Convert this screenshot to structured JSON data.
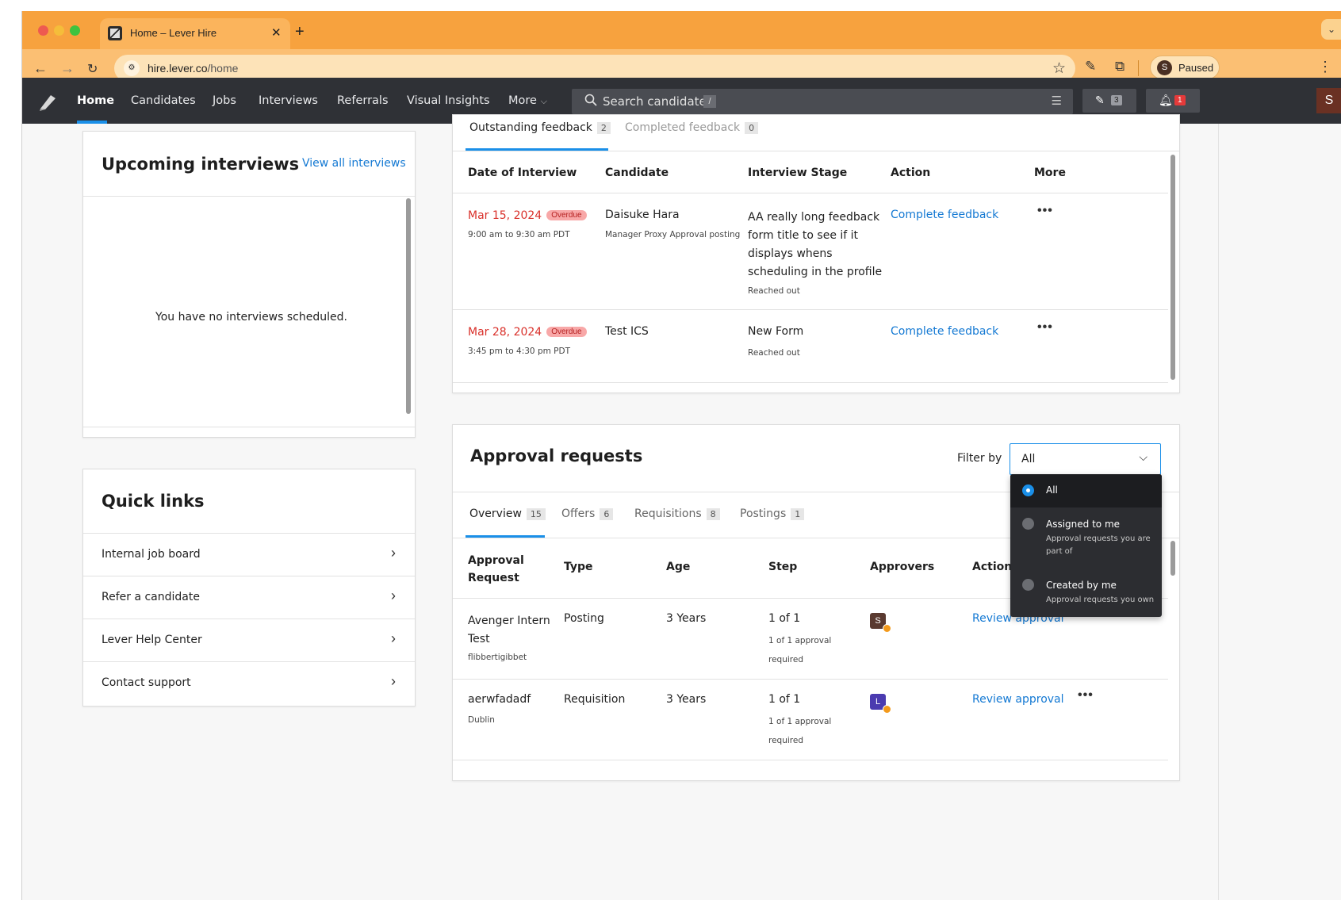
{
  "browser": {
    "tab_title": "Home – Lever Hire",
    "url_host": "hire.lever.co",
    "url_path": "/home",
    "profile_initial": "S",
    "profile_status": "Paused",
    "accent_color": "#f7a23e"
  },
  "nav": {
    "items": [
      "Home",
      "Candidates",
      "Jobs",
      "Interviews",
      "Referrals",
      "Visual Insights",
      "More"
    ],
    "search_placeholder": "Search candidates",
    "search_shortcut": "/",
    "tasks_count": "3",
    "notifications_count": "1",
    "user_initial": "S"
  },
  "upcoming": {
    "title": "Upcoming interviews",
    "view_all": "View all interviews",
    "empty": "You have no interviews scheduled."
  },
  "quick_links": {
    "title": "Quick links",
    "items": [
      "Internal job board",
      "Refer a candidate",
      "Lever Help Center",
      "Contact support"
    ]
  },
  "feedback": {
    "tabs": [
      {
        "label": "Outstanding feedback",
        "count": "2"
      },
      {
        "label": "Completed feedback",
        "count": "0"
      }
    ],
    "columns": [
      "Date of Interview",
      "Candidate",
      "Interview Stage",
      "Action",
      "More"
    ],
    "rows": [
      {
        "date": "Mar 15, 2024",
        "status": "Overdue",
        "time": "9:00 am to 9:30 am PDT",
        "candidate": "Daisuke Hara",
        "posting": "Manager Proxy Approval posting",
        "stage_lines": [
          "AA really long feedback",
          "form title to see if it",
          "displays whens",
          "scheduling in the profile"
        ],
        "stage_sub": "Reached out",
        "action": "Complete feedback"
      },
      {
        "date": "Mar 28, 2024",
        "status": "Overdue",
        "time": "3:45 pm to 4:30 pm PDT",
        "candidate": "Test ICS",
        "posting": "",
        "stage_lines": [
          "New Form"
        ],
        "stage_sub": "Reached out",
        "action": "Complete feedback"
      }
    ]
  },
  "approvals": {
    "title": "Approval requests",
    "filter_label": "Filter by",
    "filter_value": "All",
    "tabs": [
      {
        "label": "Overview",
        "count": "15"
      },
      {
        "label": "Offers",
        "count": "6"
      },
      {
        "label": "Requisitions",
        "count": "8"
      },
      {
        "label": "Postings",
        "count": "1"
      }
    ],
    "columns": [
      "Approval",
      "Request",
      "Type",
      "Age",
      "Step",
      "Approvers",
      "Action"
    ],
    "rows": [
      {
        "name_lines": [
          "Avenger Intern",
          "Test"
        ],
        "sub": "flibbertigibbet",
        "type": "Posting",
        "age": "3 Years",
        "step": "1 of 1",
        "step_sub_lines": [
          "1 of 1 approval",
          "required"
        ],
        "approver_initial": "S",
        "approver_color": "#5a3a30",
        "action": "Review approval"
      },
      {
        "name_lines": [
          "aerwfadadf"
        ],
        "sub": "Dublin",
        "type": "Requisition",
        "age": "3 Years",
        "step": "1 of 1",
        "step_sub_lines": [
          "1 of 1 approval",
          "required"
        ],
        "approver_initial": "L",
        "approver_color": "#4b3bb0",
        "action": "Review approval"
      }
    ],
    "dropdown": [
      {
        "label": "All",
        "desc": "",
        "selected": true
      },
      {
        "label": "Assigned to me",
        "desc_lines": [
          "Approval requests you are",
          "part of"
        ],
        "selected": false
      },
      {
        "label": "Created by me",
        "desc_lines": [
          "Approval requests you own"
        ],
        "selected": false
      }
    ]
  }
}
